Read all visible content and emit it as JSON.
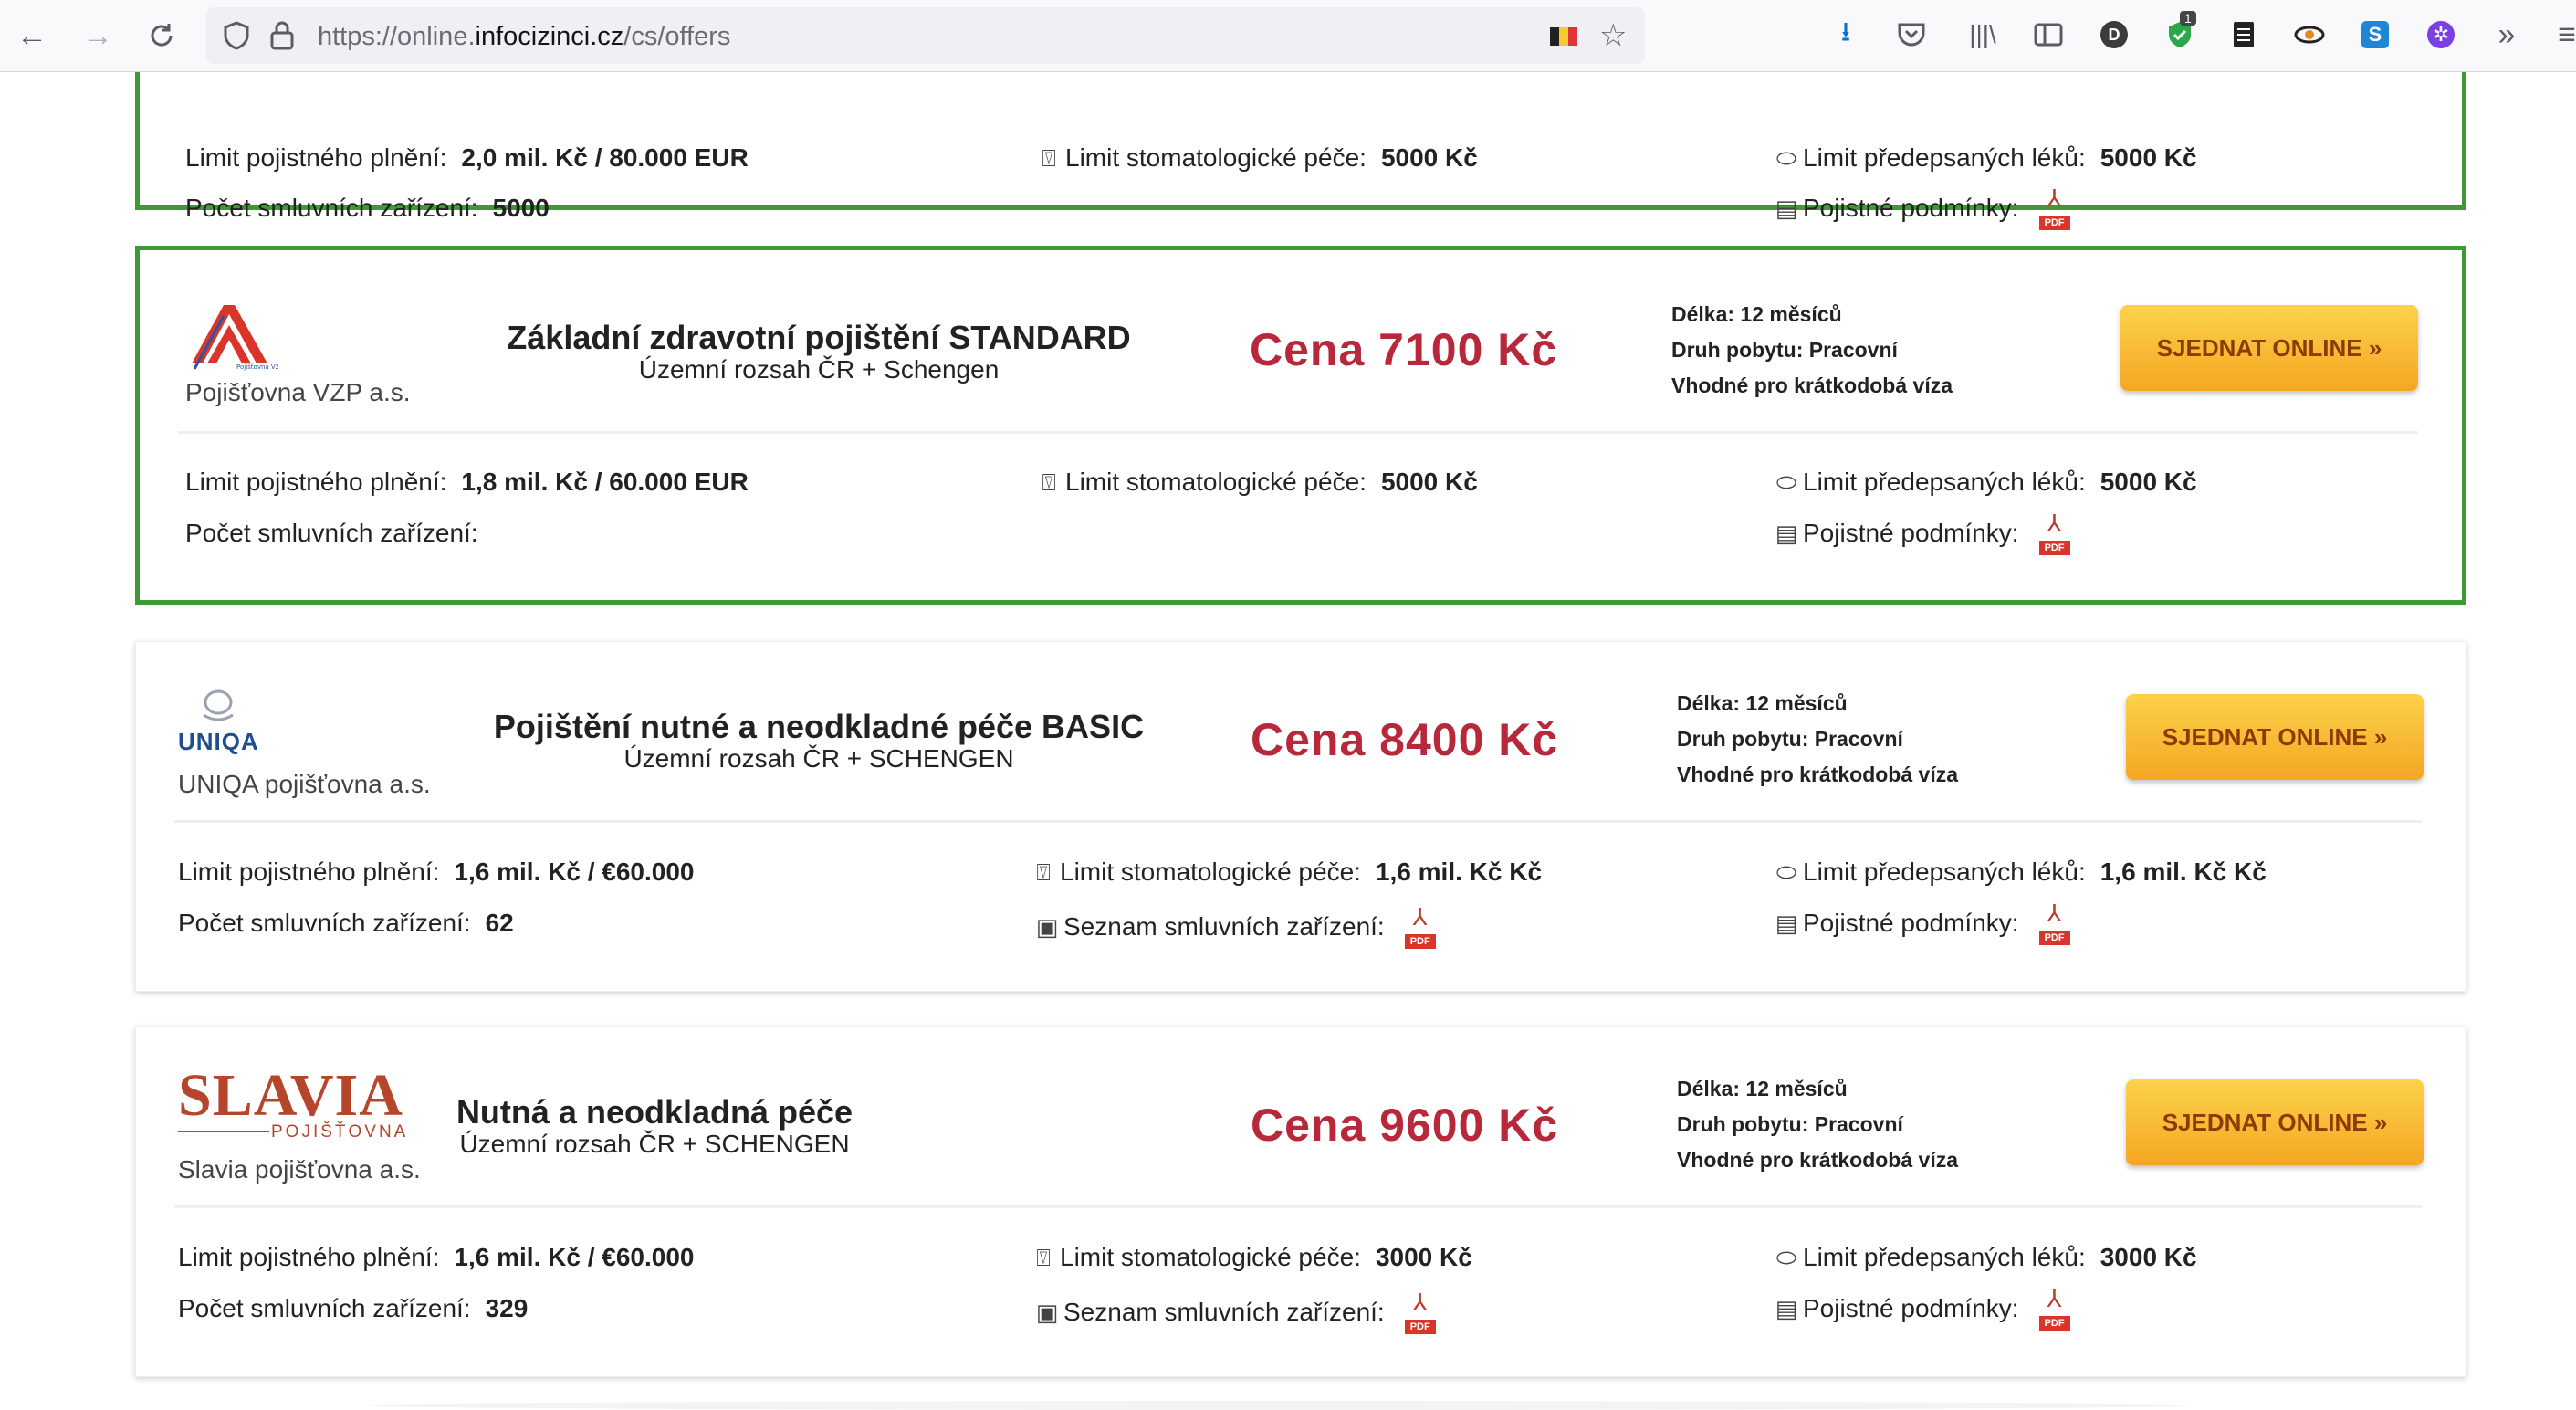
{
  "browser": {
    "url_prefix": "https://online.",
    "url_host": "infocizinci.cz",
    "url_path": "/cs/offers",
    "extension_badge": "1",
    "profile_initial": "D"
  },
  "labels": {
    "limit_plneni": "Limit pojistného plnění:",
    "limit_stomato": "Limit stomatologické péče:",
    "limit_leky": "Limit předepsaných léků:",
    "pocet_zarizeni": "Počet smluvních zařízení:",
    "podminky": "Pojistné podmínky:",
    "seznam_zarizeni": "Seznam smluvních zařízení:",
    "pdf": "PDF",
    "cta": "SJEDNAT ONLINE »"
  },
  "offers": [
    {
      "limit_plneni": "2,0 mil. Kč / 80.000 EUR",
      "limit_stomato": "5000 Kč",
      "limit_leky": "5000 Kč",
      "pocet_zarizeni": "5000"
    },
    {
      "insurer": "Pojišťovna VZP a.s.",
      "logo_caption": "Pojišťovna VZP a.s.",
      "title": "Základní zdravotní pojištění STANDARD",
      "scope": "Územní rozsah ČR + Schengen",
      "price": "Cena 7100 Kč",
      "delka": "Délka: 12 měsíců",
      "druh": "Druh pobytu: Pracovní",
      "vhodne": "Vhodné pro krátkodobá víza",
      "limit_plneni": "1,8 mil. Kč / 60.000 EUR",
      "limit_stomato": "5000 Kč",
      "limit_leky": "5000 Kč",
      "pocet_zarizeni": ""
    },
    {
      "insurer": "UNIQA pojišťovna a.s.",
      "logo_text": "UNIQA",
      "title": "Pojištění nutné a neodkladné péče BASIC",
      "scope": "Územní rozsah ČR + SCHENGEN",
      "price": "Cena 8400 Kč",
      "delka": "Délka: 12 měsíců",
      "druh": "Druh pobytu: Pracovní",
      "vhodne": "Vhodné pro krátkodobá víza",
      "limit_plneni": "1,6 mil. Kč / €60.000",
      "limit_stomato": "1,6 mil. Kč Kč",
      "limit_leky": "1,6 mil. Kč Kč",
      "pocet_zarizeni": "62"
    },
    {
      "insurer": "Slavia pojišťovna a.s.",
      "logo_text": "SLAVIA",
      "logo_sub": "POJIŠŤOVNA",
      "title": "Nutná a neodkladná péče",
      "scope": "Územní rozsah ČR + SCHENGEN",
      "price": "Cena 9600 Kč",
      "delka": "Délka: 12 měsíců",
      "druh": "Druh pobytu: Pracovní",
      "vhodne": "Vhodné pro krátkodobá víza",
      "limit_plneni": "1,6 mil. Kč / €60.000",
      "limit_stomato": "3000 Kč",
      "limit_leky": "3000 Kč",
      "pocet_zarizeni": "329"
    }
  ]
}
